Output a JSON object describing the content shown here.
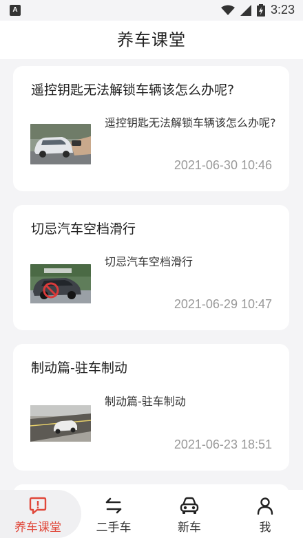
{
  "status_bar": {
    "time": "3:23",
    "app_badge": "A"
  },
  "header": {
    "title": "养车课堂"
  },
  "articles": [
    {
      "title": "遥控钥匙无法解锁车辆该怎么办呢?",
      "summary": "遥控钥匙无法解锁车辆该怎么办呢?",
      "date": "2021-06-30 10:46",
      "thumb_icon": "car-key-photo"
    },
    {
      "title": "切忌汽车空档滑行",
      "summary": "切忌汽车空档滑行",
      "date": "2021-06-29 10:47",
      "thumb_icon": "car-neutral-photo"
    },
    {
      "title": "制动篇-驻车制动",
      "summary": "制动篇-驻车制动",
      "date": "2021-06-23 18:51",
      "thumb_icon": "parked-car-photo"
    }
  ],
  "tabbar": {
    "tabs": [
      {
        "label": "养车课堂",
        "icon": "alert-message-icon",
        "active": true
      },
      {
        "label": "二手车",
        "icon": "swap-arrows-icon",
        "active": false
      },
      {
        "label": "新车",
        "icon": "car-front-icon",
        "active": false
      },
      {
        "label": "我",
        "icon": "person-icon",
        "active": false
      }
    ]
  },
  "colors": {
    "accent": "#e0473a",
    "background": "#f4f4f6",
    "date_text": "#999999"
  }
}
